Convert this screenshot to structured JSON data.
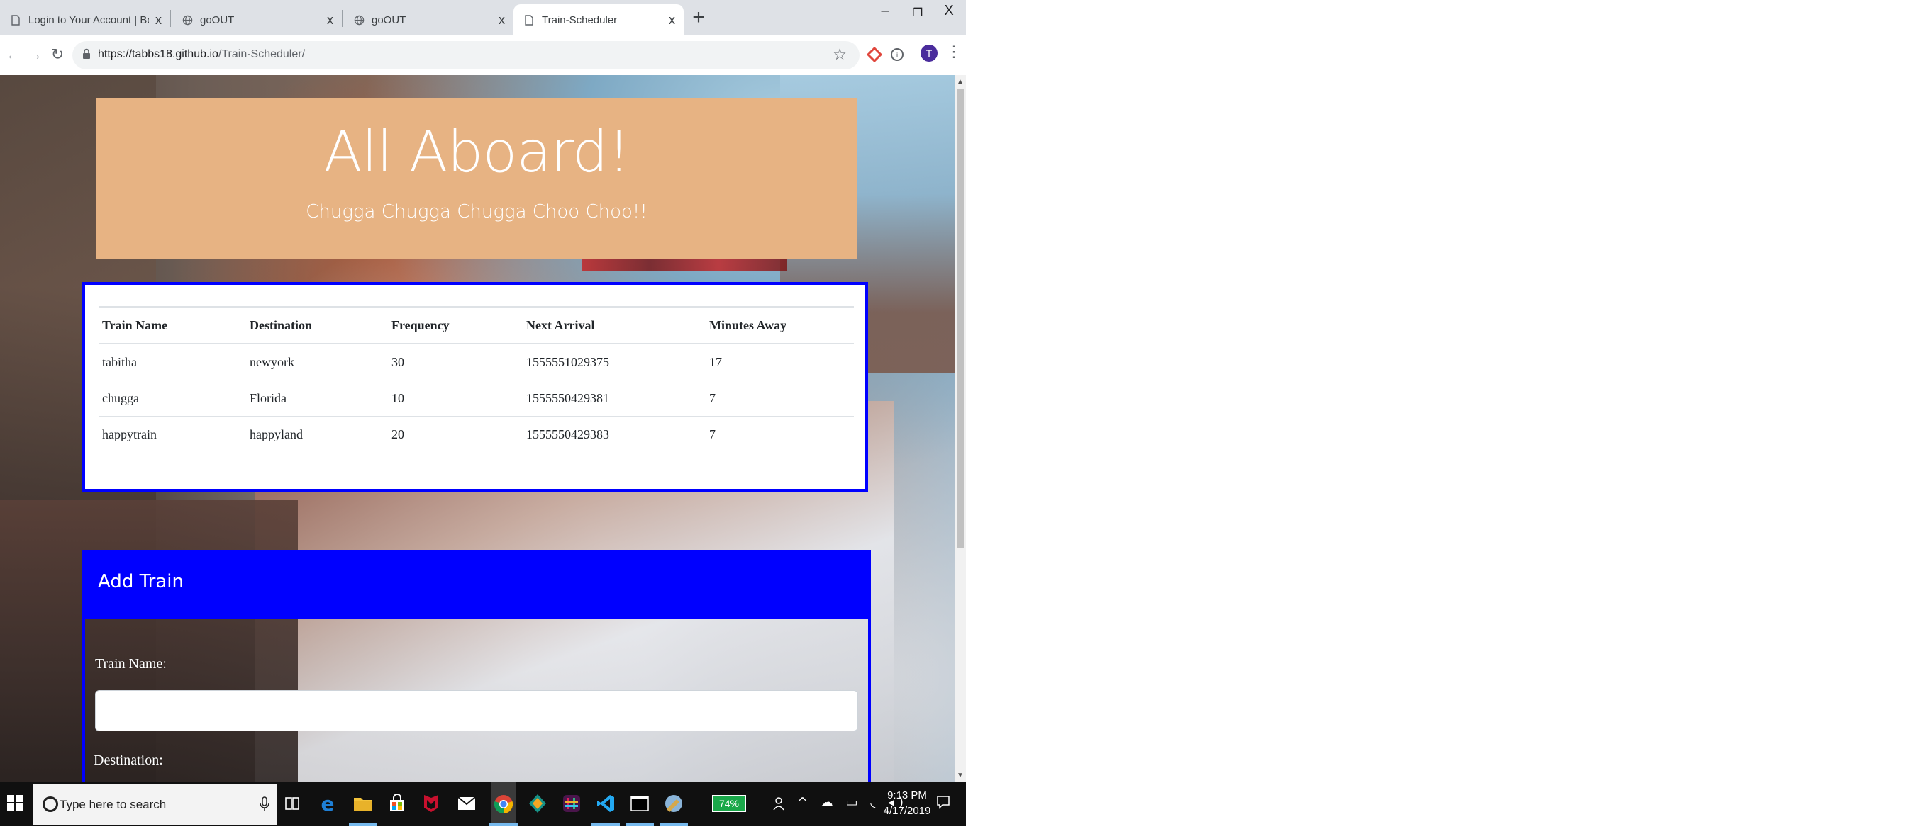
{
  "browser": {
    "tabs": [
      {
        "label": "Login to Your Account | Bootcam",
        "close": "x",
        "active": false
      },
      {
        "label": "goOUT",
        "close": "x",
        "active": false
      },
      {
        "label": "goOUT",
        "close": "x",
        "active": false
      },
      {
        "label": "Train-Scheduler",
        "close": "x",
        "active": true
      }
    ],
    "new_tab": "+",
    "window_controls": {
      "minimize": "–",
      "restore": "❐",
      "close": "X"
    },
    "url_host": "https://tabbs18.github.io",
    "url_path": "/Train-Scheduler/",
    "avatar_letter": "T"
  },
  "page": {
    "jumbotron": {
      "title": "All Aboard!",
      "subtitle": "Chugga Chugga Chugga Choo Choo!!",
      "bg_color": "#e7b383"
    },
    "schedule": {
      "columns": [
        "Train Name",
        "Destination",
        "Frequency",
        "Next Arrival",
        "Minutes Away"
      ],
      "rows": [
        [
          "tabitha",
          "newyork",
          "30",
          "1555551029375",
          "17"
        ],
        [
          "chugga",
          "Florida",
          "10",
          "1555550429381",
          "7"
        ],
        [
          "happytrain",
          "happyland",
          "20",
          "1555550429383",
          "7"
        ]
      ],
      "border_color": "#0000ff"
    },
    "add_train": {
      "title": "Add Train",
      "train_name_label": "Train Name:",
      "train_name_value": "",
      "destination_label": "Destination:",
      "header_color": "#0000ff"
    }
  },
  "taskbar": {
    "search_placeholder": "Type here to search",
    "battery": "74%",
    "time": "9:13 PM",
    "date": "4/17/2019"
  }
}
